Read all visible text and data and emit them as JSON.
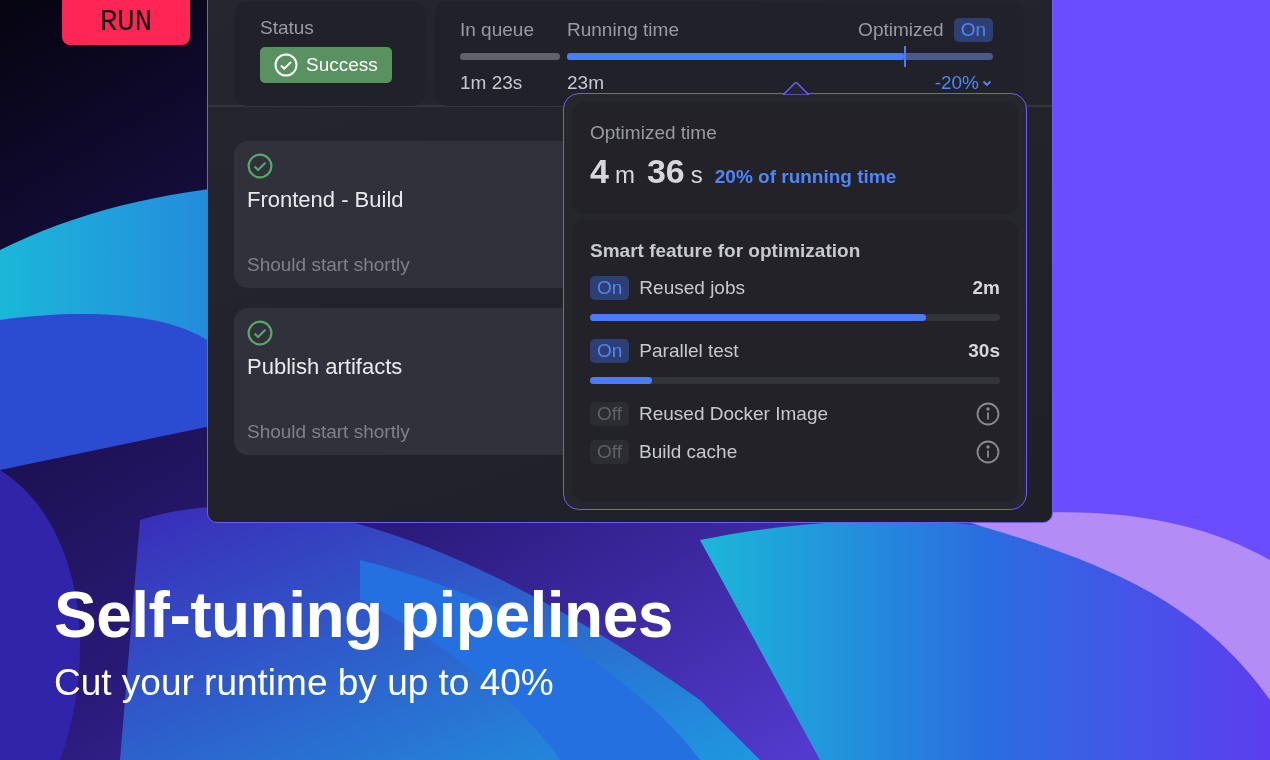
{
  "badge": "RUN",
  "status": {
    "label": "Status",
    "value": "Success"
  },
  "timing": {
    "queue": {
      "label": "In queue",
      "value": "1m 23s"
    },
    "running": {
      "label": "Running time",
      "value": "23m",
      "level": 0.79
    },
    "optimized": {
      "label": "Optimized",
      "toggle": "On",
      "on": true,
      "delta": "-20%"
    }
  },
  "jobs": [
    {
      "name": "Frontend - Build",
      "note": "Should start shortly"
    },
    {
      "name": "Publish artifacts",
      "note": "Should start shortly"
    }
  ],
  "popover": {
    "title": "Optimized time",
    "minutes": "4",
    "minutes_unit": "m",
    "seconds": "36",
    "seconds_unit": "s",
    "share": "20% of running time",
    "features_title": "Smart feature for optimization",
    "features": [
      {
        "toggle": "On",
        "on": true,
        "name": "Reused jobs",
        "value": "2m",
        "level": 0.82
      },
      {
        "toggle": "On",
        "on": true,
        "name": "Parallel test",
        "value": "30s",
        "level": 0.15
      },
      {
        "toggle": "Off",
        "on": false,
        "name": "Reused Docker Image"
      },
      {
        "toggle": "Off",
        "on": false,
        "name": "Build cache"
      }
    ]
  },
  "headline": "Self-tuning pipelines",
  "subline": "Cut your runtime by up to 40%"
}
